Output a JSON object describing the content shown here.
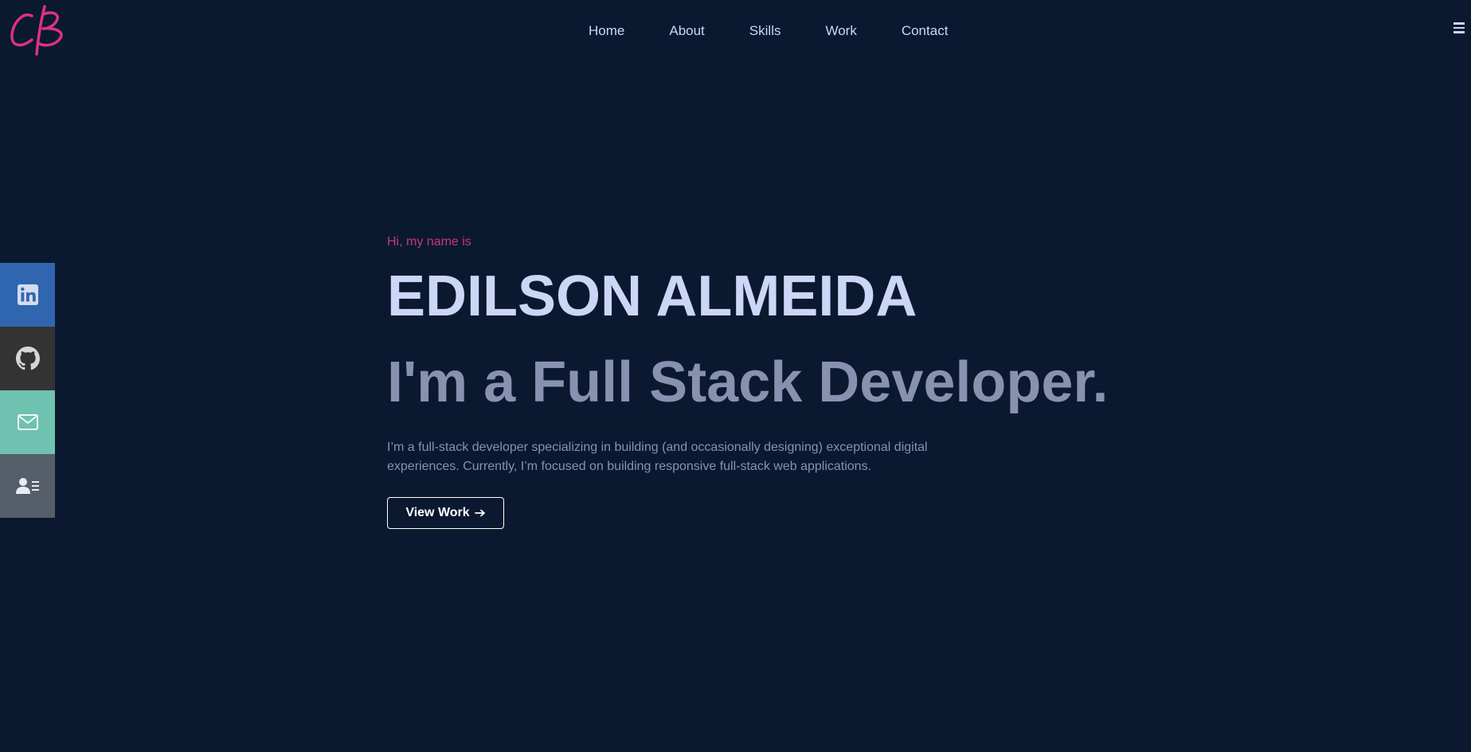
{
  "brand": {
    "logo_text": "CB",
    "logo_color": "#e0317f"
  },
  "nav": {
    "items": [
      {
        "label": "Home"
      },
      {
        "label": "About"
      },
      {
        "label": "Skills"
      },
      {
        "label": "Work"
      },
      {
        "label": "Contact"
      }
    ],
    "menu_icon": "hamburger-icon"
  },
  "social": [
    {
      "name": "linkedin",
      "icon": "linkedin-icon",
      "color": "#3066b0"
    },
    {
      "name": "github",
      "icon": "github-icon",
      "color": "#333333"
    },
    {
      "name": "email",
      "icon": "mail-icon",
      "color": "#6fc2b0"
    },
    {
      "name": "resume",
      "icon": "contact-card-icon",
      "color": "#565f69"
    }
  ],
  "hero": {
    "intro": "Hi, my name is",
    "name": "EDILSON ALMEIDA",
    "role": "I'm a Full Stack Developer.",
    "description": "I’m a full-stack developer specializing in building (and occasionally designing) exceptional digital experiences. Currently, I’m focused on building responsive full-stack web applications.",
    "cta_label": "View Work",
    "cta_icon": "arrow-right-icon"
  },
  "colors": {
    "background": "#0a192f",
    "accent": "#c6367e",
    "heading": "#ccd6f6",
    "muted": "#8892b0"
  }
}
